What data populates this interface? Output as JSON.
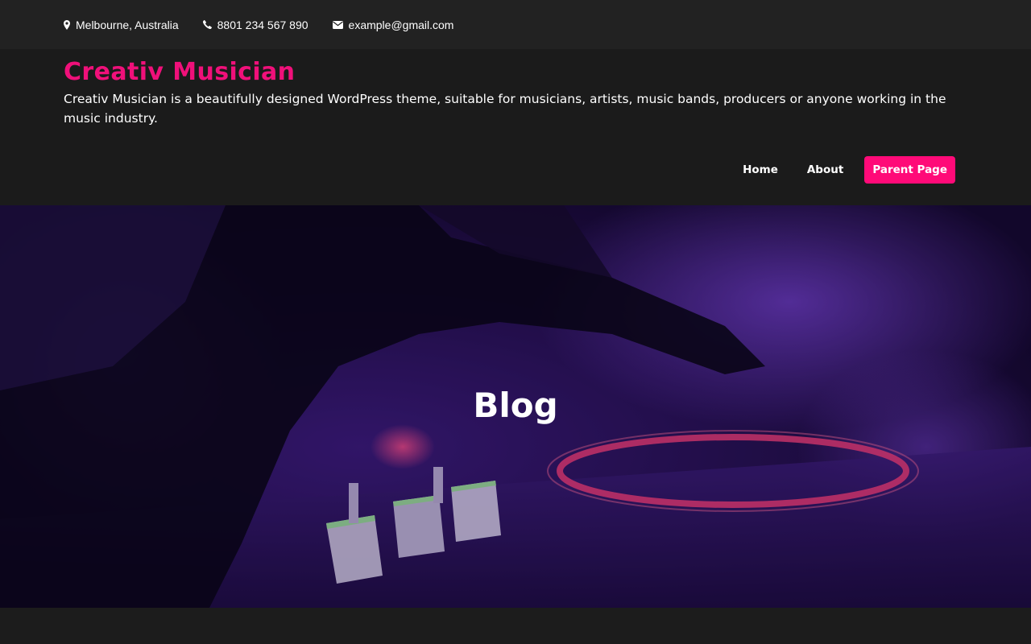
{
  "topbar": {
    "location": "Melbourne, Australia",
    "phone": "8801 234 567 890",
    "email": "example@gmail.com"
  },
  "header": {
    "title": "Creativ Musician",
    "description": "Creativ Musician is a beautifully designed WordPress theme, suitable for musicians, artists, music bands, producers or anyone working in the music industry."
  },
  "nav": {
    "items": [
      {
        "label": "Home"
      },
      {
        "label": "About"
      },
      {
        "label": "Parent Page"
      }
    ]
  },
  "hero": {
    "title": "Blog"
  },
  "colors": {
    "accent": "#ff0a78",
    "title": "#f0107a",
    "background": "#1a1a1a"
  }
}
